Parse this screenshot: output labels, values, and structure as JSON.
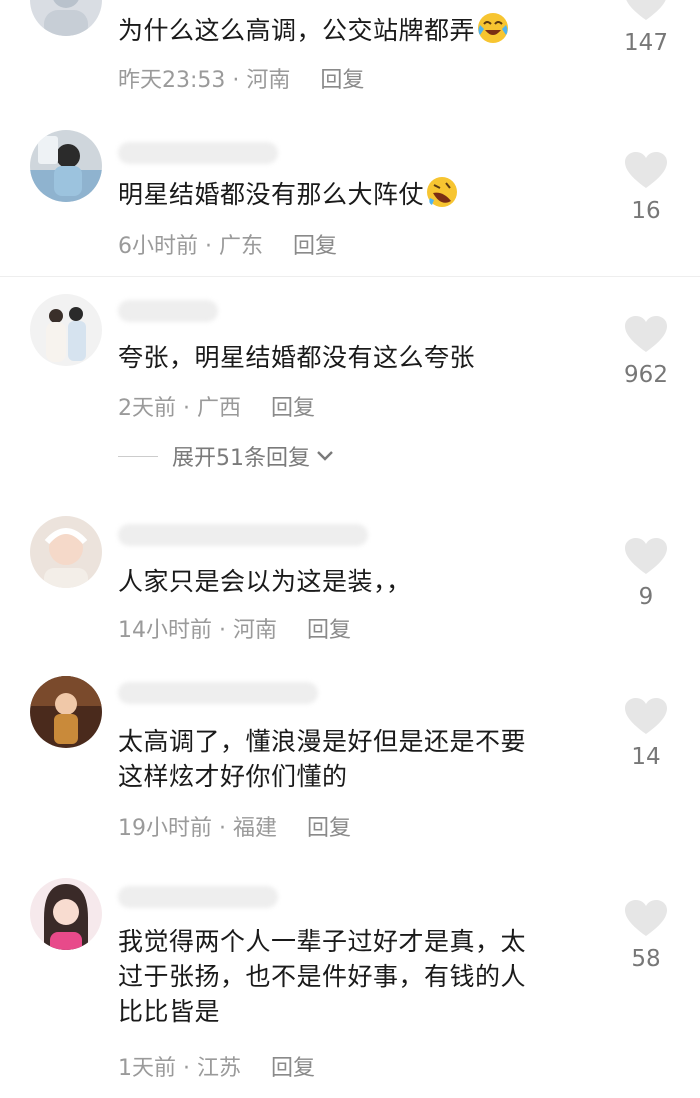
{
  "comments": [
    {
      "text": "为什么这么高调，公交站牌都弄",
      "emoji": "crying-laugh",
      "time": "昨天23:53",
      "region": "河南",
      "reply": "回复",
      "likes": "147"
    },
    {
      "text": "明星结婚都没有那么大阵仗",
      "emoji": "rolling-laugh",
      "time": "6小时前",
      "region": "广东",
      "reply": "回复",
      "likes": "16"
    },
    {
      "text": "夸张，明星结婚都没有这么夸张",
      "time": "2天前",
      "region": "广西",
      "reply": "回复",
      "likes": "962",
      "expand": "展开51条回复"
    },
    {
      "text": "人家只是会以为这是装，，",
      "time": "14小时前",
      "region": "河南",
      "reply": "回复",
      "likes": "9"
    },
    {
      "text_line1": "太高调了，懂浪漫是好但是还是不要",
      "text_line2": "这样炫才好你们懂的",
      "time": "19小时前",
      "region": "福建",
      "reply": "回复",
      "likes": "14"
    },
    {
      "text_line1": "我觉得两个人一辈子过好才是真，太",
      "text_line2": "过于张扬，也不是件好事，有钱的人",
      "text_line3": "比比皆是",
      "time": "1天前",
      "region": "江苏",
      "reply": "回复",
      "likes": "58"
    }
  ],
  "colors": {
    "text": "#1a1a1a",
    "meta": "#9a9a9a",
    "heart": "#e6e6e6",
    "divider": "#eeeeee"
  },
  "icons": [
    "heart-icon",
    "chevron-down-icon",
    "crying-laugh-emoji",
    "rolling-laugh-emoji"
  ]
}
